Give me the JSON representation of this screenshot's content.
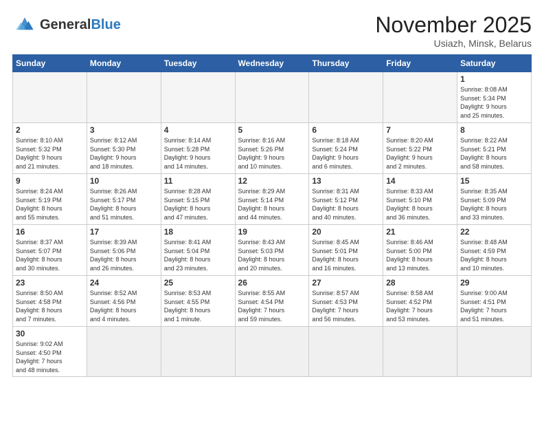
{
  "header": {
    "logo_general": "General",
    "logo_blue": "Blue",
    "month_title": "November 2025",
    "location": "Usiazh, Minsk, Belarus"
  },
  "days_of_week": [
    "Sunday",
    "Monday",
    "Tuesday",
    "Wednesday",
    "Thursday",
    "Friday",
    "Saturday"
  ],
  "weeks": [
    [
      {
        "day": "",
        "info": ""
      },
      {
        "day": "",
        "info": ""
      },
      {
        "day": "",
        "info": ""
      },
      {
        "day": "",
        "info": ""
      },
      {
        "day": "",
        "info": ""
      },
      {
        "day": "",
        "info": ""
      },
      {
        "day": "1",
        "info": "Sunrise: 8:08 AM\nSunset: 5:34 PM\nDaylight: 9 hours\nand 25 minutes."
      }
    ],
    [
      {
        "day": "2",
        "info": "Sunrise: 8:10 AM\nSunset: 5:32 PM\nDaylight: 9 hours\nand 21 minutes."
      },
      {
        "day": "3",
        "info": "Sunrise: 8:12 AM\nSunset: 5:30 PM\nDaylight: 9 hours\nand 18 minutes."
      },
      {
        "day": "4",
        "info": "Sunrise: 8:14 AM\nSunset: 5:28 PM\nDaylight: 9 hours\nand 14 minutes."
      },
      {
        "day": "5",
        "info": "Sunrise: 8:16 AM\nSunset: 5:26 PM\nDaylight: 9 hours\nand 10 minutes."
      },
      {
        "day": "6",
        "info": "Sunrise: 8:18 AM\nSunset: 5:24 PM\nDaylight: 9 hours\nand 6 minutes."
      },
      {
        "day": "7",
        "info": "Sunrise: 8:20 AM\nSunset: 5:22 PM\nDaylight: 9 hours\nand 2 minutes."
      },
      {
        "day": "8",
        "info": "Sunrise: 8:22 AM\nSunset: 5:21 PM\nDaylight: 8 hours\nand 58 minutes."
      }
    ],
    [
      {
        "day": "9",
        "info": "Sunrise: 8:24 AM\nSunset: 5:19 PM\nDaylight: 8 hours\nand 55 minutes."
      },
      {
        "day": "10",
        "info": "Sunrise: 8:26 AM\nSunset: 5:17 PM\nDaylight: 8 hours\nand 51 minutes."
      },
      {
        "day": "11",
        "info": "Sunrise: 8:28 AM\nSunset: 5:15 PM\nDaylight: 8 hours\nand 47 minutes."
      },
      {
        "day": "12",
        "info": "Sunrise: 8:29 AM\nSunset: 5:14 PM\nDaylight: 8 hours\nand 44 minutes."
      },
      {
        "day": "13",
        "info": "Sunrise: 8:31 AM\nSunset: 5:12 PM\nDaylight: 8 hours\nand 40 minutes."
      },
      {
        "day": "14",
        "info": "Sunrise: 8:33 AM\nSunset: 5:10 PM\nDaylight: 8 hours\nand 36 minutes."
      },
      {
        "day": "15",
        "info": "Sunrise: 8:35 AM\nSunset: 5:09 PM\nDaylight: 8 hours\nand 33 minutes."
      }
    ],
    [
      {
        "day": "16",
        "info": "Sunrise: 8:37 AM\nSunset: 5:07 PM\nDaylight: 8 hours\nand 30 minutes."
      },
      {
        "day": "17",
        "info": "Sunrise: 8:39 AM\nSunset: 5:06 PM\nDaylight: 8 hours\nand 26 minutes."
      },
      {
        "day": "18",
        "info": "Sunrise: 8:41 AM\nSunset: 5:04 PM\nDaylight: 8 hours\nand 23 minutes."
      },
      {
        "day": "19",
        "info": "Sunrise: 8:43 AM\nSunset: 5:03 PM\nDaylight: 8 hours\nand 20 minutes."
      },
      {
        "day": "20",
        "info": "Sunrise: 8:45 AM\nSunset: 5:01 PM\nDaylight: 8 hours\nand 16 minutes."
      },
      {
        "day": "21",
        "info": "Sunrise: 8:46 AM\nSunset: 5:00 PM\nDaylight: 8 hours\nand 13 minutes."
      },
      {
        "day": "22",
        "info": "Sunrise: 8:48 AM\nSunset: 4:59 PM\nDaylight: 8 hours\nand 10 minutes."
      }
    ],
    [
      {
        "day": "23",
        "info": "Sunrise: 8:50 AM\nSunset: 4:58 PM\nDaylight: 8 hours\nand 7 minutes."
      },
      {
        "day": "24",
        "info": "Sunrise: 8:52 AM\nSunset: 4:56 PM\nDaylight: 8 hours\nand 4 minutes."
      },
      {
        "day": "25",
        "info": "Sunrise: 8:53 AM\nSunset: 4:55 PM\nDaylight: 8 hours\nand 1 minute."
      },
      {
        "day": "26",
        "info": "Sunrise: 8:55 AM\nSunset: 4:54 PM\nDaylight: 7 hours\nand 59 minutes."
      },
      {
        "day": "27",
        "info": "Sunrise: 8:57 AM\nSunset: 4:53 PM\nDaylight: 7 hours\nand 56 minutes."
      },
      {
        "day": "28",
        "info": "Sunrise: 8:58 AM\nSunset: 4:52 PM\nDaylight: 7 hours\nand 53 minutes."
      },
      {
        "day": "29",
        "info": "Sunrise: 9:00 AM\nSunset: 4:51 PM\nDaylight: 7 hours\nand 51 minutes."
      }
    ],
    [
      {
        "day": "30",
        "info": "Sunrise: 9:02 AM\nSunset: 4:50 PM\nDaylight: 7 hours\nand 48 minutes."
      },
      {
        "day": "",
        "info": ""
      },
      {
        "day": "",
        "info": ""
      },
      {
        "day": "",
        "info": ""
      },
      {
        "day": "",
        "info": ""
      },
      {
        "day": "",
        "info": ""
      },
      {
        "day": "",
        "info": ""
      }
    ]
  ]
}
